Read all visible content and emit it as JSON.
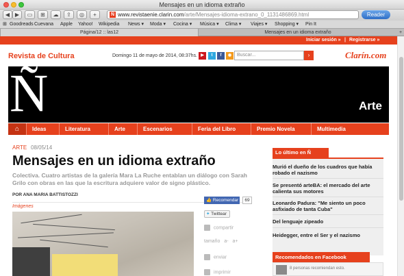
{
  "window": {
    "title": "Mensajes en un idioma extraño"
  },
  "toolbar": {
    "url_host": "www.revistaenie.clarin.com",
    "url_path": "/arte/Mensajes-idioma-extrano_0_1131486869.html",
    "reader_label": "Reader"
  },
  "bookmarks": [
    "Goodreads",
    "Cuevana",
    "Apple",
    "Yahoo!",
    "Wikipedia",
    "News ▾",
    "Moda ▾",
    "Cocina ▾",
    "Música ▾",
    "Clima ▾",
    "Viajes ▾",
    "Shopping ▾",
    "Pin It"
  ],
  "tabs": [
    {
      "label": "Página/12 :: las12",
      "active": true
    },
    {
      "label": "Mensajes en un idioma extraño",
      "active": false
    }
  ],
  "topbar": {
    "login": "Iniciar sesión »",
    "separator": "|",
    "register": "Registrarse »"
  },
  "header": {
    "site_name": "Revista de Cultura",
    "date": "Domingo 11 de mayo de 2014, 08:37hs.",
    "search_placeholder": "Buscar...",
    "brand": "Clarín.com"
  },
  "hero": {
    "logo": "Ñ",
    "section": "Arte"
  },
  "nav": {
    "items": [
      "Ideas",
      "Literatura",
      "Arte",
      "Escenarios",
      "Feria del Libro",
      "Premio Novela",
      "Multimedia"
    ]
  },
  "article": {
    "kicker": "ARTE",
    "date": "08/05/14",
    "title": "Mensajes en un idioma extraño",
    "lead": "Colectiva. Cuatro artistas de la galería Mara La Ruche entablan un diálogo con Sarah Grilo con obras en las que la escritura adquiere valor de signo plástico.",
    "byline": "POR ANA MARIA BATTISTOZZI",
    "images_label": "Imágenes"
  },
  "share": {
    "facebook_label": "Recomendar",
    "facebook_count": "69",
    "twitter_label": "Twittear",
    "actions": [
      "compartir",
      "tamaño",
      "enviar",
      "imprimir"
    ],
    "size_minus": "a-",
    "size_plus": "a+"
  },
  "sidebar": {
    "latest_title": "Lo último en Ñ",
    "latest": [
      "Murió el dueño de los cuadros que había robado el nazismo",
      "Se presentó arteBA: el mercado del arte calienta sus motores",
      "Leonardo Padura: \"Me siento un poco asfixiado de tanta Cuba\"",
      "Del lenguaje zipeado",
      "Heidegger, entre el Ser y el nazismo"
    ],
    "facebook_title": "Recomendados en Facebook",
    "facebook_text": "8 personas recomiendan esto."
  },
  "colors": {
    "accent": "#e6411d",
    "hero_bg": "#000000",
    "facebook": "#4267b2"
  }
}
